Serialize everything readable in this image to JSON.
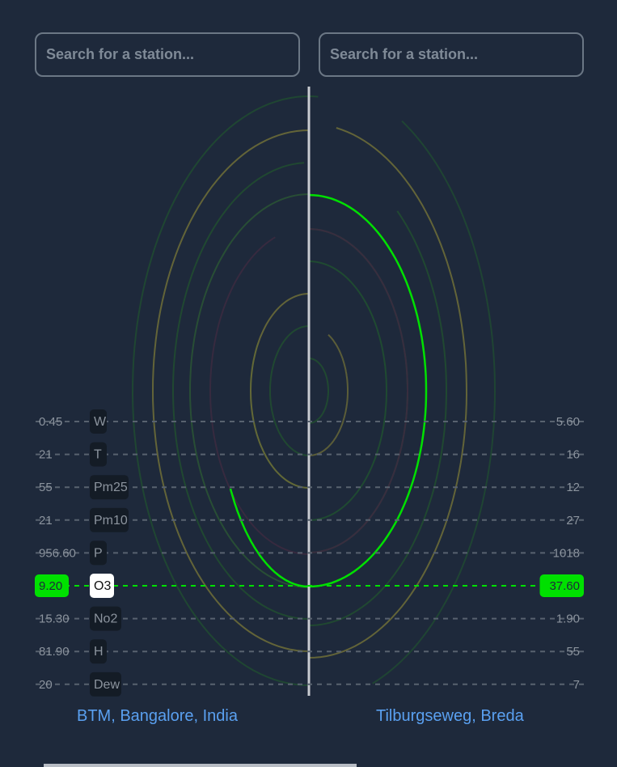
{
  "search": {
    "left_placeholder": "Search for a station...",
    "right_placeholder": "Search for a station..."
  },
  "stations": {
    "left": "BTM, Bangalore, India",
    "right": "Tilburgseweg, Breda"
  },
  "colors": {
    "background": "#1e293b",
    "dashed_line": "#58626f",
    "label_bg": "#141c26",
    "label_text": "#8c949e",
    "selected": "#00e000",
    "divider": "#c9ccd1",
    "station_link": "#5aa0f0"
  },
  "selected_metric": "O3",
  "metrics": [
    {
      "label": "W",
      "left": "0.45",
      "right": "5.60",
      "color": "#205030"
    },
    {
      "label": "T",
      "left": "21",
      "right": "16",
      "color": "#6a6a38"
    },
    {
      "label": "Pm25",
      "left": "55",
      "right": "12",
      "color": "#205030"
    },
    {
      "label": "Pm10",
      "left": "21",
      "right": "27",
      "color": "#2a5535"
    },
    {
      "label": "P",
      "left": "956.60",
      "right": "1018",
      "color": "#3a2a40"
    },
    {
      "label": "O3",
      "left": "9.20",
      "right": "37.60",
      "color": "#00e000"
    },
    {
      "label": "No2",
      "left": "15.30",
      "right": "1.90",
      "color": "#205030"
    },
    {
      "label": "H",
      "left": "81.90",
      "right": "55",
      "color": "#6a6a38"
    },
    {
      "label": "Dew",
      "left": "20",
      "right": "7",
      "color": "#205030"
    }
  ]
}
